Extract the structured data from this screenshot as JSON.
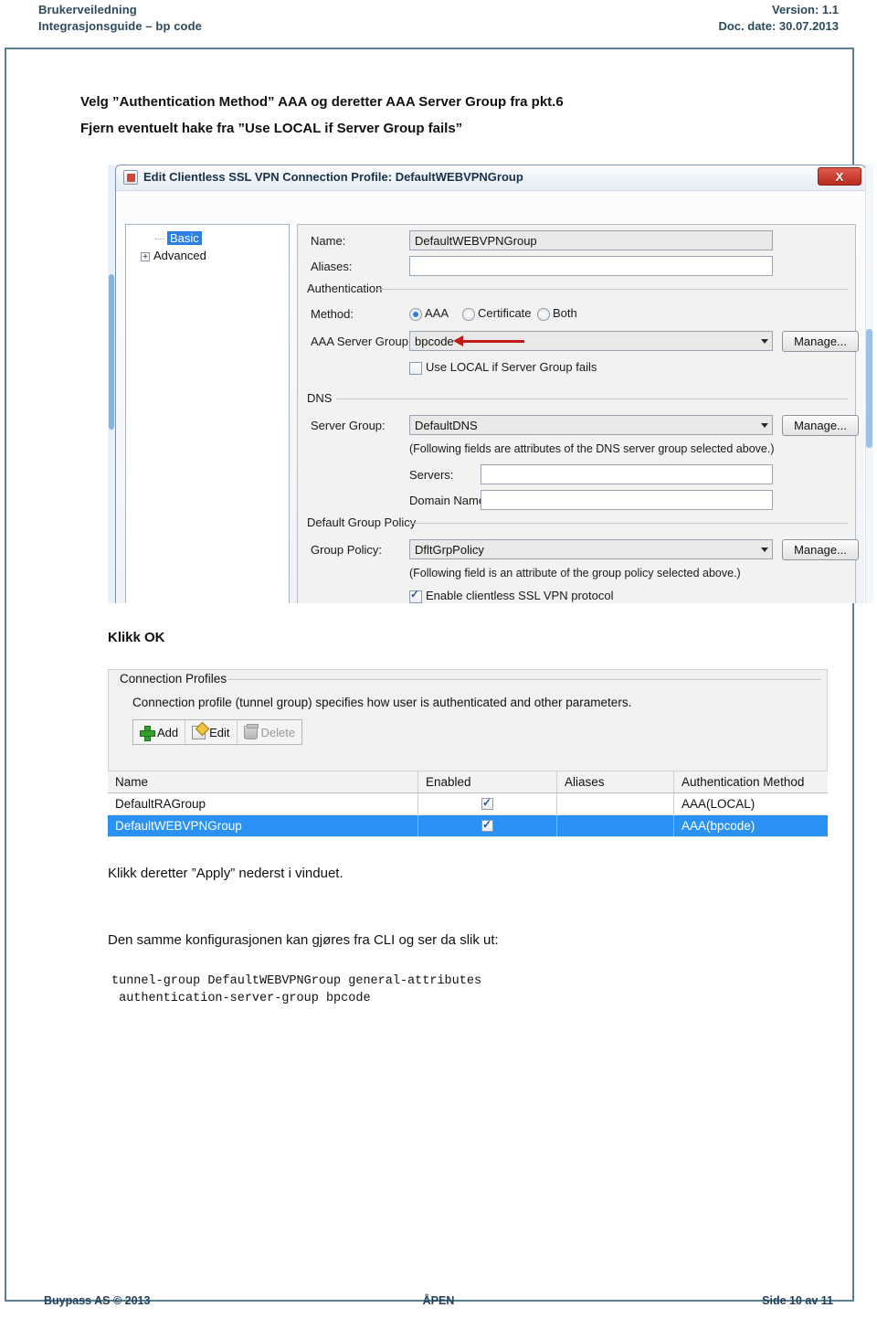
{
  "doc_header": {
    "left_line1": "Brukerveiledning",
    "left_line2": "Integrasjonsguide – bp code",
    "right_line1": "Version: 1.1",
    "right_line2": "Doc. date: 30.07.2013"
  },
  "doc_footer": {
    "left": "Buypass AS © 2013",
    "center": "ÅPEN",
    "right": "Side 10 av 11"
  },
  "body": {
    "intro_line1": "Velg ”Authentication Method” AAA og deretter AAA Server Group fra pkt.6",
    "intro_line2": "Fjern eventuelt hake fra ”Use LOCAL if Server Group fails”",
    "klikk_ok": "Klikk OK",
    "klikk_apply": "Klikk deretter ”Apply” nederst i vinduet.",
    "cli_intro": "Den samme konfigurasjonen kan gjøres fra CLI og ser da slik ut:",
    "cli_line1": "tunnel-group DefaultWEBVPNGroup general-attributes",
    "cli_line2": " authentication-server-group bpcode"
  },
  "dialog": {
    "title": "Edit Clientless SSL VPN Connection Profile: DefaultWEBVPNGroup",
    "close_label": "X",
    "tree": {
      "items": [
        {
          "label": "Basic",
          "selected": true
        },
        {
          "label": "Advanced",
          "selected": false,
          "expander": "+"
        }
      ]
    },
    "fields": {
      "name_label": "Name:",
      "name_value": "DefaultWEBVPNGroup",
      "aliases_label": "Aliases:",
      "aliases_value": ""
    },
    "authentication": {
      "caption": "Authentication",
      "method_label": "Method:",
      "options": [
        {
          "label": "AAA",
          "selected": true
        },
        {
          "label": "Certificate",
          "selected": false
        },
        {
          "label": "Both",
          "selected": false
        }
      ],
      "server_group_label": "AAA Server Group:",
      "server_group_value": "bpcode",
      "manage_label": "Manage...",
      "use_local_label": "Use LOCAL if Server Group fails",
      "use_local_checked": false
    },
    "dns": {
      "caption": "DNS",
      "server_group_label": "Server Group:",
      "server_group_value": "DefaultDNS",
      "manage_label": "Manage...",
      "note": "(Following fields are attributes of the DNS server group selected above.)",
      "servers_label": "Servers:",
      "servers_value": "",
      "domain_label": "Domain Name:",
      "domain_value": ""
    },
    "default_group_policy": {
      "caption": "Default Group Policy",
      "policy_label": "Group Policy:",
      "policy_value": "DfltGrpPolicy",
      "manage_label": "Manage...",
      "note": "(Following field is an attribute of the group policy selected above.)",
      "enable_label": "Enable clientless SSL VPN protocol",
      "enable_checked": true
    },
    "annotation": {
      "arrow_color": "#c01b18"
    }
  },
  "connection_profiles": {
    "caption": "Connection Profiles",
    "description": "Connection profile (tunnel group) specifies how user is authenticated and other parameters.",
    "toolbar": [
      {
        "label": "Add",
        "icon": "plus-icon",
        "disabled": false
      },
      {
        "label": "Edit",
        "icon": "pencil-icon",
        "disabled": false
      },
      {
        "label": "Delete",
        "icon": "trash-icon",
        "disabled": true
      }
    ],
    "table": {
      "columns": [
        "Name",
        "Enabled",
        "Aliases",
        "Authentication Method"
      ],
      "rows": [
        {
          "name": "DefaultRAGroup",
          "enabled": true,
          "aliases": "",
          "auth": "AAA(LOCAL)",
          "selected": false
        },
        {
          "name": "DefaultWEBVPNGroup",
          "enabled": true,
          "aliases": "",
          "auth": "AAA(bpcode)",
          "selected": true
        }
      ]
    }
  },
  "colors": {
    "header_blue": "#2d4a5c",
    "frame_border": "#5b7f8c",
    "selection_blue": "#2a92f5",
    "annotation_red": "#c01b18"
  }
}
